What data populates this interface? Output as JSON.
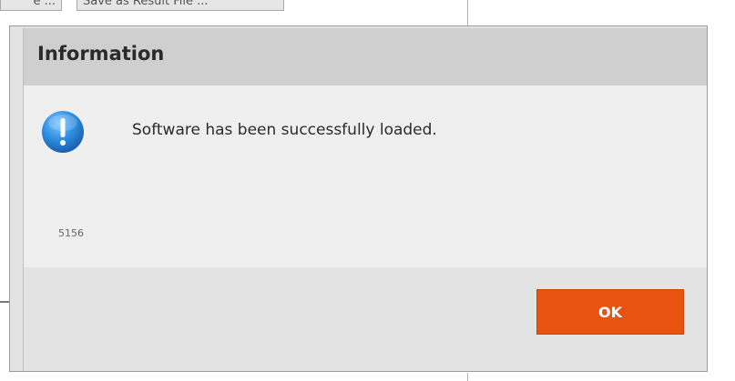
{
  "background": {
    "left_button_label": "e ...",
    "right_button_label": "Save as Result File ..."
  },
  "dialog": {
    "title": "Information",
    "message": "Software has been successfully loaded.",
    "code": "5156",
    "ok_label": "OK",
    "icon": "info-exclamation-icon"
  },
  "colors": {
    "title_bar": "#cfcfcf",
    "content_bg": "#efefef",
    "footer_bg": "#e3e3e3",
    "ok_button": "#e8540f",
    "icon_blue": "#2f8ee0"
  }
}
